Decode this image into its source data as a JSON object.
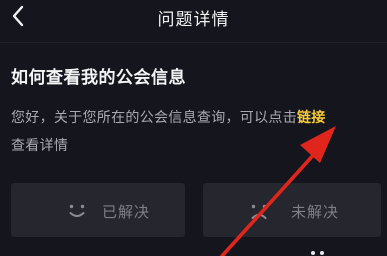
{
  "nav": {
    "title": "问题详情"
  },
  "question": {
    "title": "如何查看我的公会信息"
  },
  "answer": {
    "text_before_link": "您好，关于您所在的公会信息查询，可以点击",
    "link_label": "链接",
    "text_after_link": "查看详情"
  },
  "feedback": {
    "solved_label": "已解决",
    "unsolved_label": "未解决"
  },
  "colors": {
    "background": "#15161d",
    "button_background": "#25262e",
    "link": "#f5c93c",
    "annotation_arrow": "#e0261c"
  },
  "icons": {
    "back": "chevron-left-icon",
    "solved": "smile-face-icon",
    "unsolved": "sad-face-icon"
  }
}
